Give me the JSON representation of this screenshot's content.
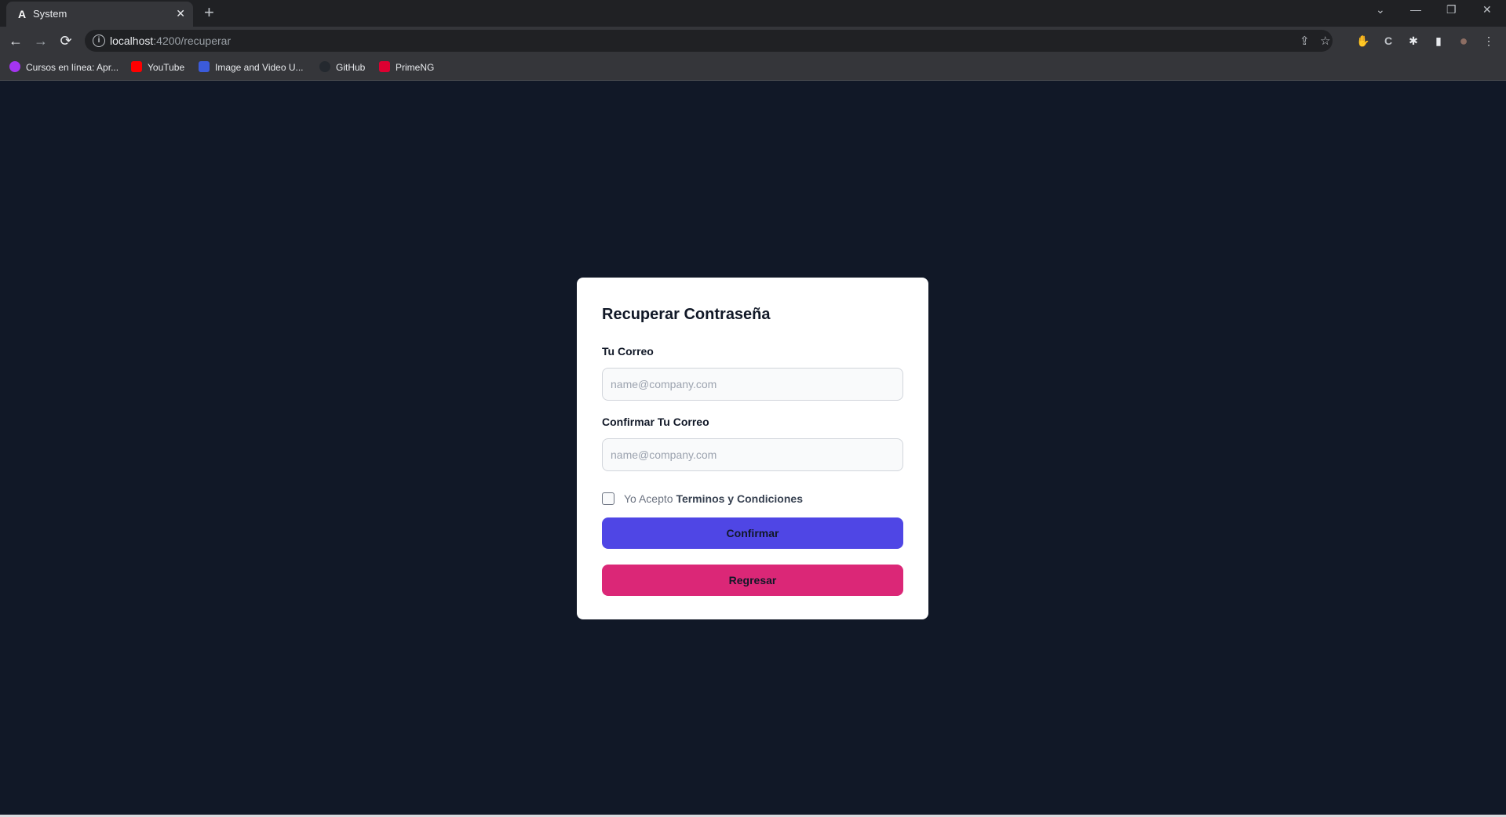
{
  "browser": {
    "tab": {
      "favicon": "A",
      "title": "System",
      "close": "✕"
    },
    "new_tab": "+",
    "window_controls": {
      "tab_search": "⌄",
      "minimize": "—",
      "restore": "❐",
      "close": "✕"
    },
    "nav": {
      "back": "←",
      "forward": "→",
      "reload": "⟳"
    },
    "address": {
      "host": "localhost",
      "path": ":4200/recuperar"
    },
    "omni_actions": {
      "share": "⇪",
      "bookmark": "☆"
    },
    "extensions": {
      "adblock": "✋",
      "ext2": "C",
      "puzzle": "✱",
      "sidepanel": "▮",
      "profile": "●",
      "menu": "⋮"
    },
    "bookmarks": [
      {
        "label": "Cursos en línea: Apr...",
        "icon": "udemy-icon",
        "color": "#a435f0"
      },
      {
        "label": "YouTube",
        "icon": "youtube-icon",
        "color": "#ff0000"
      },
      {
        "label": "Image and Video U...",
        "icon": "image-upload-icon",
        "color": "#3b5bdb"
      },
      {
        "label": "GitHub",
        "icon": "github-icon",
        "color": "#24292f"
      },
      {
        "label": "PrimeNG",
        "icon": "primeng-icon",
        "color": "#dd0031"
      }
    ]
  },
  "form": {
    "title": "Recuperar Contraseña",
    "email_label": "Tu Correo",
    "email_placeholder": "name@company.com",
    "confirm_label": "Confirmar Tu Correo",
    "confirm_placeholder": "name@company.com",
    "terms_prefix": "Yo Acepto",
    "terms_link": "Terminos y Condiciones",
    "confirm_button": "Confirmar",
    "back_button": "Regresar"
  },
  "colors": {
    "page_bg": "#111827",
    "primary": "#4f46e5",
    "secondary": "#db2777"
  }
}
